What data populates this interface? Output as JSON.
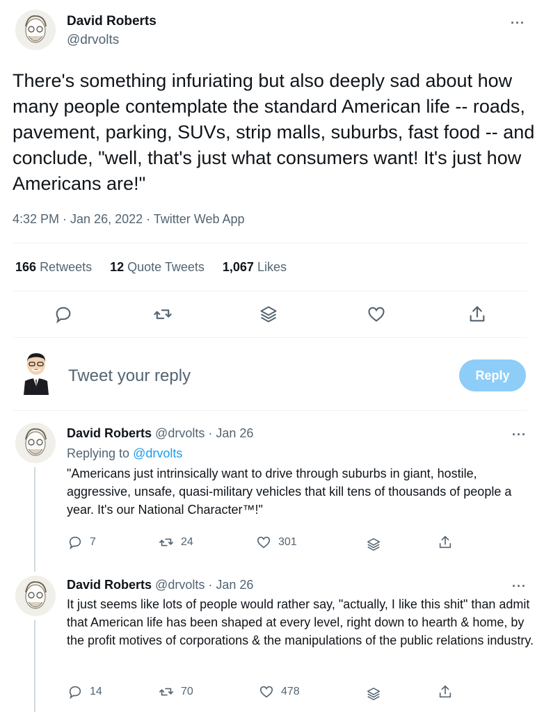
{
  "main_tweet": {
    "author_name": "David Roberts",
    "author_handle": "@drvolts",
    "text": "There's something infuriating but also deeply sad about how many people contemplate the standard American life -- roads, pavement, parking, SUVs, strip malls, suburbs, fast food -- and conclude, \"well, that's just what consumers want! It's just how Americans are!\"",
    "meta": "4:32 PM · Jan 26, 2022 · Twitter Web App",
    "retweets_count": "166",
    "retweets_label": "Retweets",
    "quotes_count": "12",
    "quotes_label": "Quote Tweets",
    "likes_count": "1,067",
    "likes_label": "Likes",
    "more": "···"
  },
  "composer": {
    "placeholder": "Tweet your reply",
    "reply_label": "Reply"
  },
  "replies": [
    {
      "author_name": "David Roberts",
      "author_handle": "@drvolts",
      "date": "· Jan 26",
      "replying_to_label": "Replying to",
      "replying_to_handle": "@drvolts",
      "text": "\"Americans just intrinsically want to drive through suburbs in giant, hostile, aggressive, unsafe, quasi-military vehicles that kill tens of thousands of people a year. It's our National Character™!\"",
      "reply_count": "7",
      "retweet_count": "24",
      "like_count": "301",
      "more": "···"
    },
    {
      "author_name": "David Roberts",
      "author_handle": "@drvolts",
      "date": "· Jan 26",
      "text": "It just seems like lots of people would rather say, \"actually, I like this shit\" than admit that American life has been shaped at every level, right down to hearth & home, by the profit motives of corporations & the manipulations of the public relations industry.",
      "reply_count": "14",
      "retweet_count": "70",
      "like_count": "478",
      "more": "···"
    }
  ],
  "colors": {
    "accent": "#1d9bf0",
    "reply_button_disabled": "#8ecdf8",
    "secondary_text": "#536471"
  }
}
